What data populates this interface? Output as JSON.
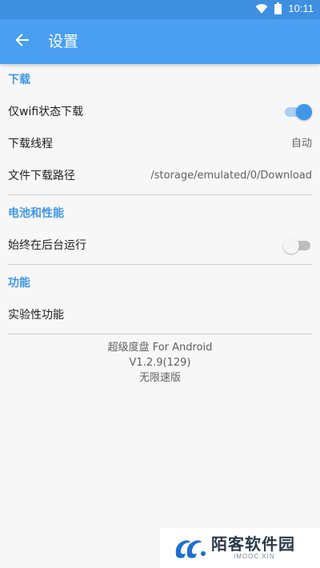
{
  "status_bar": {
    "time": "10:11"
  },
  "app_bar": {
    "title": "设置"
  },
  "sections": [
    {
      "header": "下载",
      "items": [
        {
          "label": "仅wifi状态下载",
          "switch": true
        },
        {
          "label": "下载线程",
          "value": "自动"
        },
        {
          "label": "文件下载路径",
          "value": "/storage/emulated/0/Download"
        }
      ]
    },
    {
      "header": "电池和性能",
      "items": [
        {
          "label": "始终在后台运行",
          "switch": false
        }
      ]
    },
    {
      "header": "功能",
      "items": [
        {
          "label": "实验性功能"
        }
      ]
    }
  ],
  "footer": {
    "app_name": "超级度盘 For Android",
    "version": "V1.2.9(129)",
    "edition": "无限速版"
  },
  "watermark": {
    "text": "陌客软件园",
    "subtext": "IMOOC.XIN"
  },
  "colors": {
    "app_bar": "#4a9ff2",
    "status_bar": "#3e8fe0",
    "accent": "#3f97e8",
    "background": "#f7f7f7"
  },
  "icons": {
    "back": "arrow-left-icon",
    "wifi": "wifi-icon",
    "battery": "battery-icon"
  }
}
